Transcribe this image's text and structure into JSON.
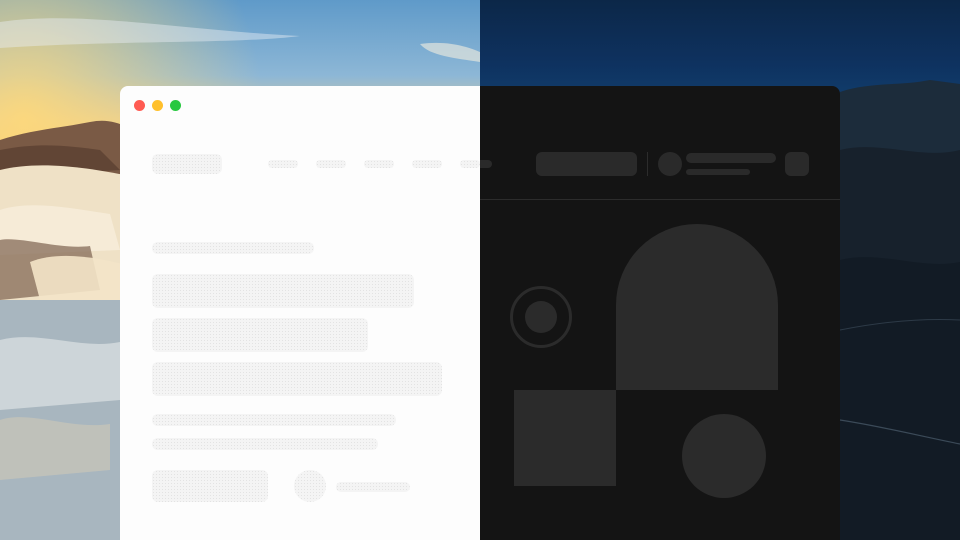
{
  "window": {
    "controls": [
      "close",
      "minimize",
      "maximize"
    ],
    "theme_split": [
      "light",
      "dark"
    ]
  },
  "colors": {
    "close": "#ff5b52",
    "minimize": "#ffc02c",
    "maximize": "#28c840",
    "light_surface": "#fdfdfd",
    "dark_surface": "#141414",
    "dark_shape": "#2b2b2b"
  },
  "header": {
    "nav_item_count": 5
  },
  "hero": {
    "illustration": [
      "ring-circle",
      "arch",
      "square",
      "circle"
    ]
  }
}
